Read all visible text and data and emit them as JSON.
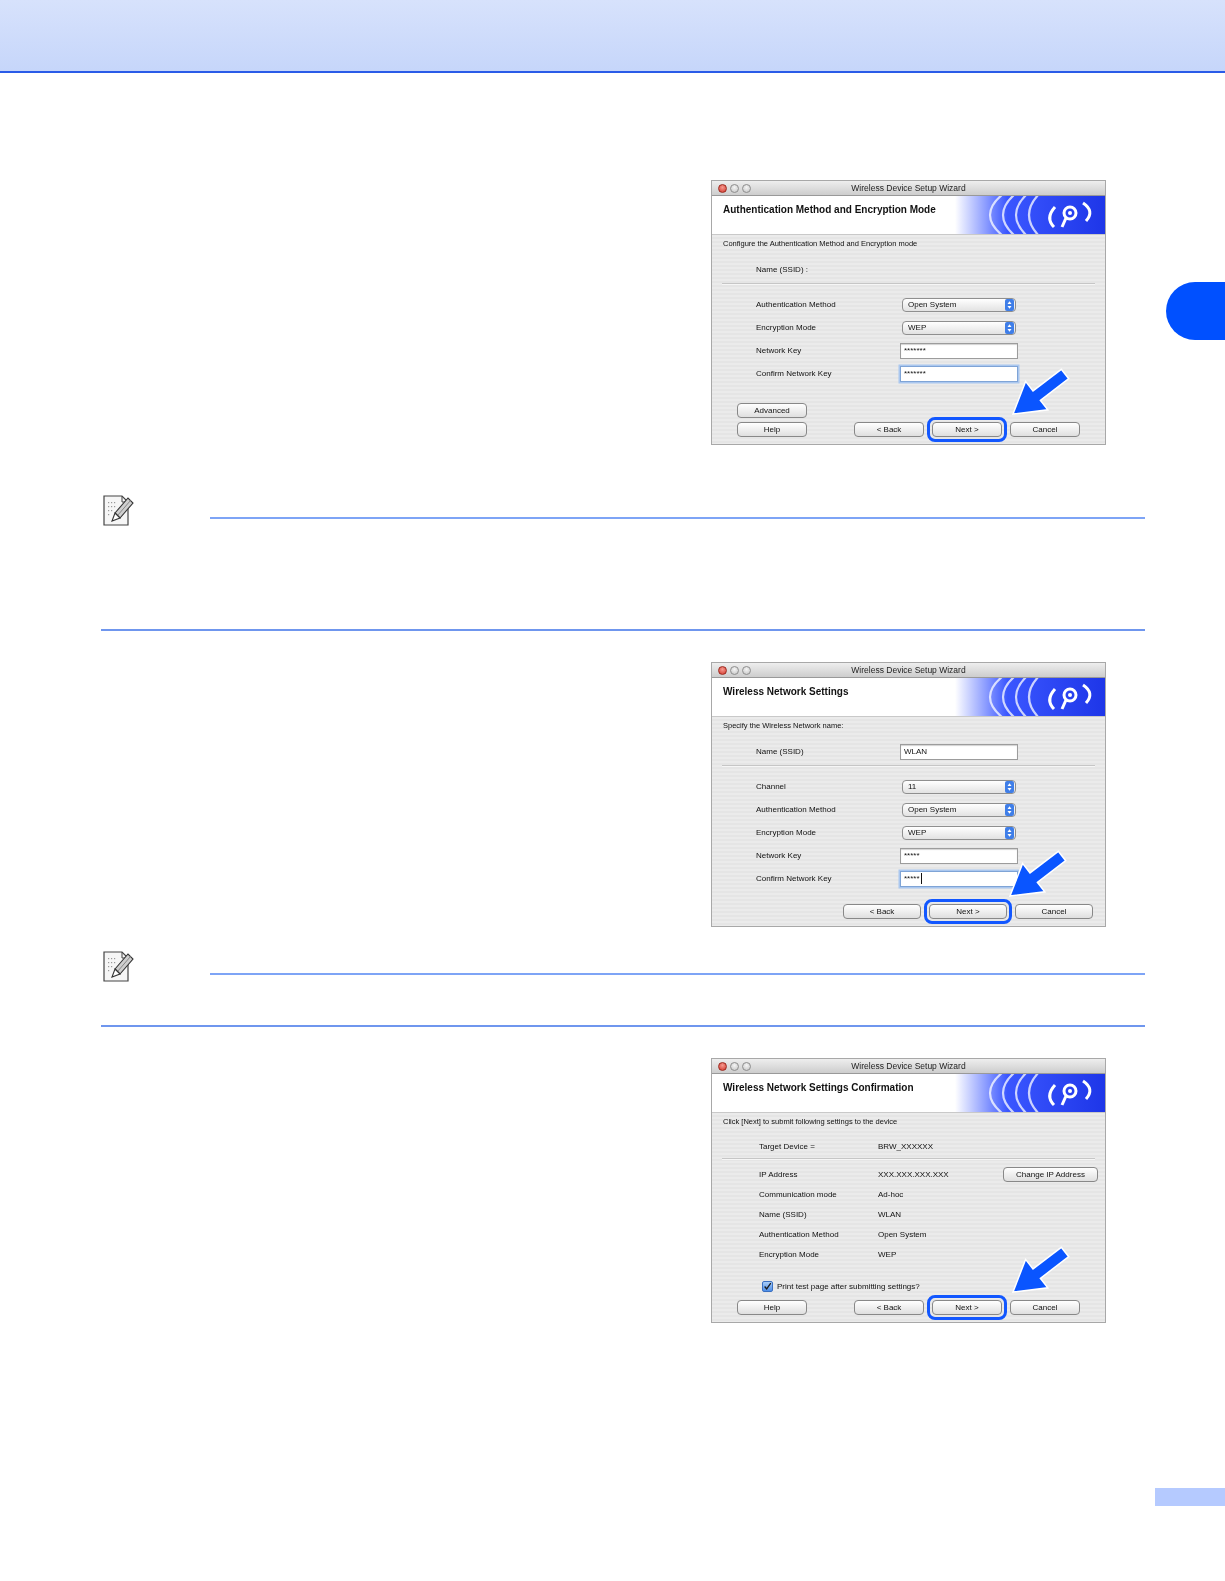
{
  "sections": [
    {
      "kind": "dialog",
      "window_title": "Wireless Device Setup Wizard",
      "heading": "Authentication Method and Encryption Mode",
      "instruction": "Configure the Authentication Method and Encryption mode",
      "top_rows": [
        {
          "kind": "label",
          "label": "Name (SSID) :"
        }
      ],
      "rows": [
        {
          "kind": "select",
          "label": "Authentication Method",
          "value": "Open System"
        },
        {
          "kind": "select",
          "label": "Encryption Mode",
          "value": "WEP"
        },
        {
          "kind": "password",
          "label": "Network Key",
          "value": "*******",
          "focused": false,
          "caret": false
        },
        {
          "kind": "password",
          "label": "Confirm Network Key",
          "value": "*******",
          "focused": true,
          "caret": false
        }
      ],
      "extra_buttons": [
        {
          "label": "Advanced"
        }
      ],
      "buttons": [
        {
          "kind": "help",
          "label": "Help",
          "highlighted": false
        },
        {
          "kind": "nav",
          "label": "< Back",
          "highlighted": false
        },
        {
          "kind": "nav",
          "label": "Next >",
          "highlighted": true
        },
        {
          "kind": "nav",
          "label": "Cancel",
          "highlighted": false
        }
      ]
    },
    {
      "kind": "note"
    },
    {
      "kind": "dialog",
      "window_title": "Wireless Device Setup Wizard",
      "heading": "Wireless Network Settings",
      "instruction": "Specify the Wireless Network name:",
      "top_rows": [
        {
          "kind": "text",
          "label": "Name (SSID)",
          "value": "WLAN",
          "focused": false,
          "caret": false
        }
      ],
      "rows": [
        {
          "kind": "select",
          "label": "Channel",
          "value": "11"
        },
        {
          "kind": "select",
          "label": "Authentication Method",
          "value": "Open System"
        },
        {
          "kind": "select",
          "label": "Encryption Mode",
          "value": "WEP"
        },
        {
          "kind": "password",
          "label": "Network Key",
          "value": "*****",
          "focused": false,
          "caret": false
        },
        {
          "kind": "password",
          "label": "Confirm Network Key",
          "value": "*****",
          "focused": true,
          "caret": true
        }
      ],
      "buttons": [
        {
          "kind": "nav",
          "label": "< Back",
          "highlighted": false
        },
        {
          "kind": "nav",
          "label": "Next >",
          "highlighted": true
        },
        {
          "kind": "nav",
          "label": "Cancel",
          "highlighted": false
        }
      ]
    },
    {
      "kind": "note"
    },
    {
      "kind": "dialog",
      "window_title": "Wireless Device Setup Wizard",
      "heading": "Wireless Network Settings Confirmation",
      "instruction": "Click [Next] to submit following settings to the device",
      "top_rows": [
        {
          "kind": "info",
          "label": "Target Device =",
          "value": "BRW_XXXXXX"
        }
      ],
      "rows": [
        {
          "kind": "info",
          "label": "IP Address",
          "value": "XXX.XXX.XXX.XXX",
          "button": "Change IP Address"
        },
        {
          "kind": "info",
          "label": "Communication mode",
          "value": "Ad-hoc"
        },
        {
          "kind": "info",
          "label": "Name (SSID)",
          "value": "WLAN"
        },
        {
          "kind": "info",
          "label": "Authentication Method",
          "value": "Open System"
        },
        {
          "kind": "info",
          "label": "Encryption Mode",
          "value": "WEP"
        }
      ],
      "options": [
        {
          "label": "Print test page after submitting settings?",
          "checked": true
        }
      ],
      "buttons": [
        {
          "kind": "help",
          "label": "Help",
          "highlighted": false
        },
        {
          "kind": "nav",
          "label": "< Back",
          "highlighted": false
        },
        {
          "kind": "nav",
          "label": "Next >",
          "highlighted": true
        },
        {
          "kind": "nav",
          "label": "Cancel",
          "highlighted": false
        }
      ]
    }
  ]
}
